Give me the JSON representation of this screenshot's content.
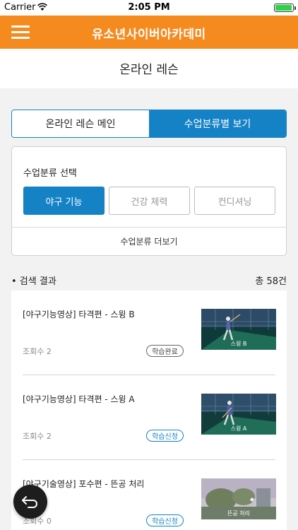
{
  "status_bar": {
    "carrier": "Carrier",
    "time": "2:05 PM",
    "battery_level": 0.9,
    "battery_color": "#2bd24a"
  },
  "header": {
    "logo_text": "유소년사이버아카데미",
    "menu_icon": "hamburger-icon",
    "bg_color": "#f58a1f"
  },
  "page": {
    "title": "온라인 레슨"
  },
  "tabs": [
    {
      "label": "온라인 레슨 메인",
      "active": false
    },
    {
      "label": "수업분류별 보기",
      "active": true
    }
  ],
  "category": {
    "title": "수업분류 선택",
    "options": [
      {
        "label": "야구 기능",
        "active": true
      },
      {
        "label": "건강 체력",
        "active": false
      },
      {
        "label": "컨디셔닝",
        "active": false
      }
    ],
    "more_label": "수업분류 더보기"
  },
  "results": {
    "label": "• 검색 결과",
    "count": "총 58건",
    "items": [
      {
        "title": "[야구기능영상] 타격편 - 스윙 B",
        "views": "조회수 2",
        "badge": "학습완료",
        "badge_type": "done",
        "thumb_caption": "스윙 B"
      },
      {
        "title": "[야구기능영상] 타격편 - 스윙 A",
        "views": "조회수 2",
        "badge": "학습신청",
        "badge_type": "apply",
        "thumb_caption": "스윙 A"
      },
      {
        "title": "[야구기술영상] 포수편 - 뜬공 처리",
        "views": "조회수 0",
        "badge": "학습신청",
        "badge_type": "apply",
        "thumb_caption": "뜬공 처리"
      }
    ]
  },
  "colors": {
    "accent": "#1482c5",
    "brand": "#f58a1f"
  },
  "fab": {
    "icon": "back-arrow-icon"
  }
}
